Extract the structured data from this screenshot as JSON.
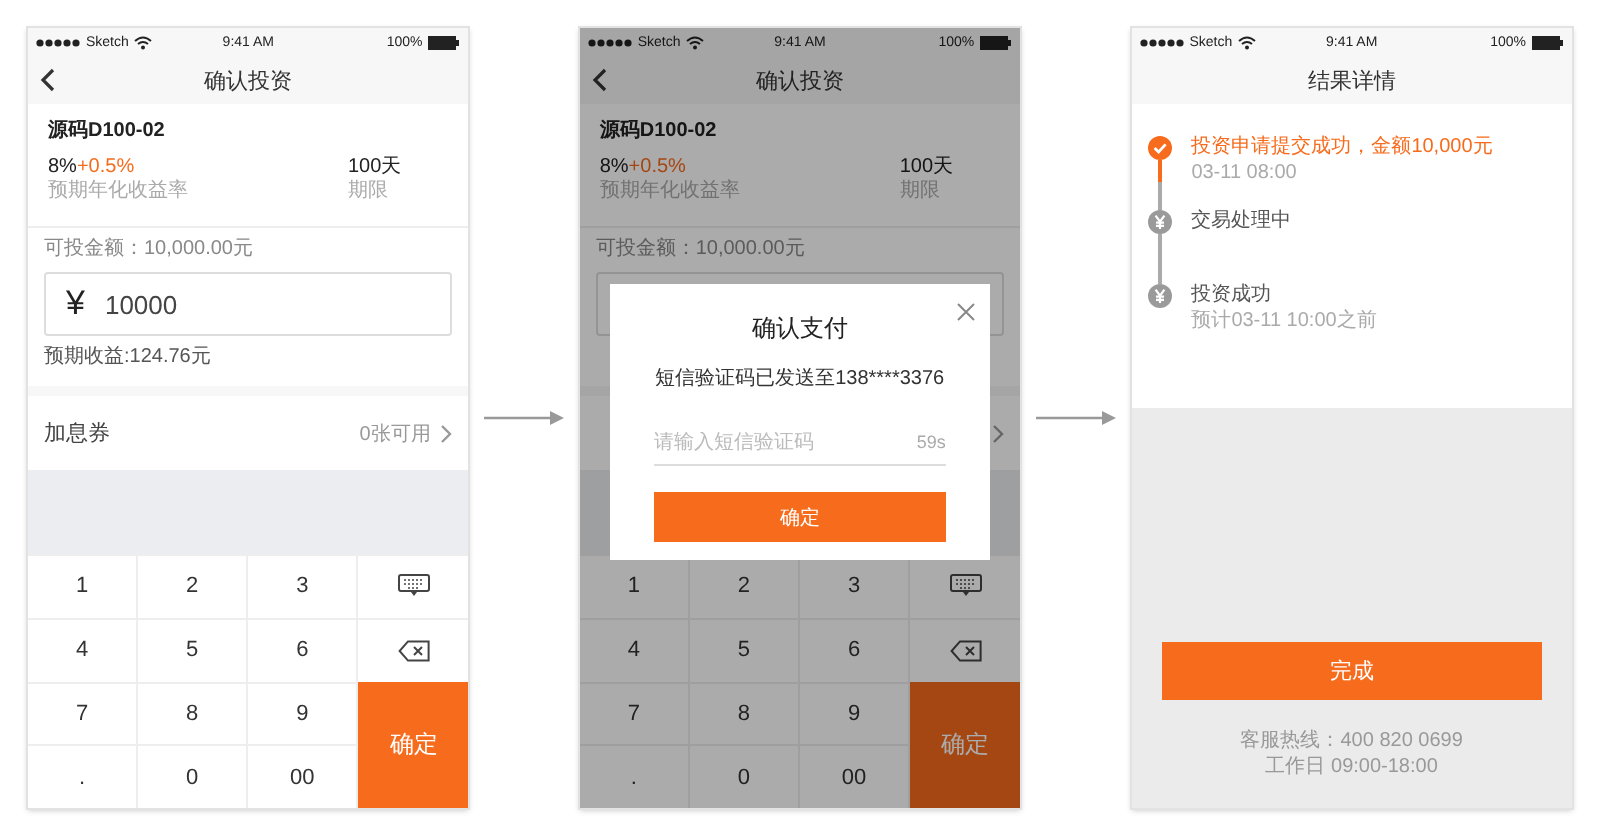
{
  "screens": [
    {
      "kind": "invest",
      "status_bar": {
        "carrier": "Sketch",
        "time": "9:41 AM",
        "battery": "100%"
      },
      "nav": {
        "title": "确认投资",
        "back": true
      },
      "product": {
        "name": "源码D100-02",
        "rate": "8%",
        "bonus": "+0.5%",
        "rate_label": "预期年化收益率",
        "term": "100天",
        "term_label": "期限"
      },
      "available": "可投金额：10,000.00元",
      "amount": {
        "currency": "¥",
        "value": "10000"
      },
      "expected": "预期收益:124.76元",
      "coupon": {
        "label": "加息券",
        "count": "0张可用"
      },
      "keypad": {
        "keys": [
          "1",
          "2",
          "3",
          "4",
          "5",
          "6",
          "7",
          "8",
          "9",
          ".",
          "0",
          "00"
        ],
        "side": [
          {
            "kind": "hide"
          },
          {
            "kind": "backspace"
          }
        ],
        "confirm": "确定"
      }
    },
    {
      "kind": "invest",
      "status_bar": {
        "carrier": "Sketch",
        "time": "9:41 AM",
        "battery": "100%"
      },
      "nav": {
        "title": "确认投资",
        "back": true
      },
      "product": {
        "name": "源码D100-02",
        "rate": "8%",
        "bonus": "+0.5%",
        "rate_label": "预期年化收益率",
        "term": "100天",
        "term_label": "期限"
      },
      "available": "可投金额：10,000.00元",
      "keypad": {
        "keys": [
          "1",
          "2",
          "3",
          "4",
          "5",
          "6",
          "7",
          "8",
          "9",
          ".",
          "0",
          "00"
        ],
        "side": [
          {
            "kind": "hide"
          },
          {
            "kind": "backspace"
          }
        ],
        "confirm": "确定"
      },
      "dialog": {
        "title": "确认支付",
        "message": "短信验证码已发送至138****3376",
        "placeholder": "请输入短信验证码",
        "countdown": "59s",
        "button": "确定"
      }
    },
    {
      "kind": "result",
      "status_bar": {
        "carrier": "Sketch",
        "time": "9:41 AM",
        "battery": "100%"
      },
      "nav": {
        "title": "结果详情",
        "back": false
      },
      "steps": [
        {
          "title": "投资申请提交成功，金额10,000元",
          "time": "03-11  08:00",
          "done": true
        },
        {
          "title": "交易处理中",
          "done": false
        },
        {
          "title": "投资成功",
          "time": "预计03-11 10:00之前",
          "done": false
        }
      ],
      "button": "完成",
      "hotline": "客服热线：400 820 0699",
      "hours": "工作日 09:00-18:00"
    }
  ]
}
